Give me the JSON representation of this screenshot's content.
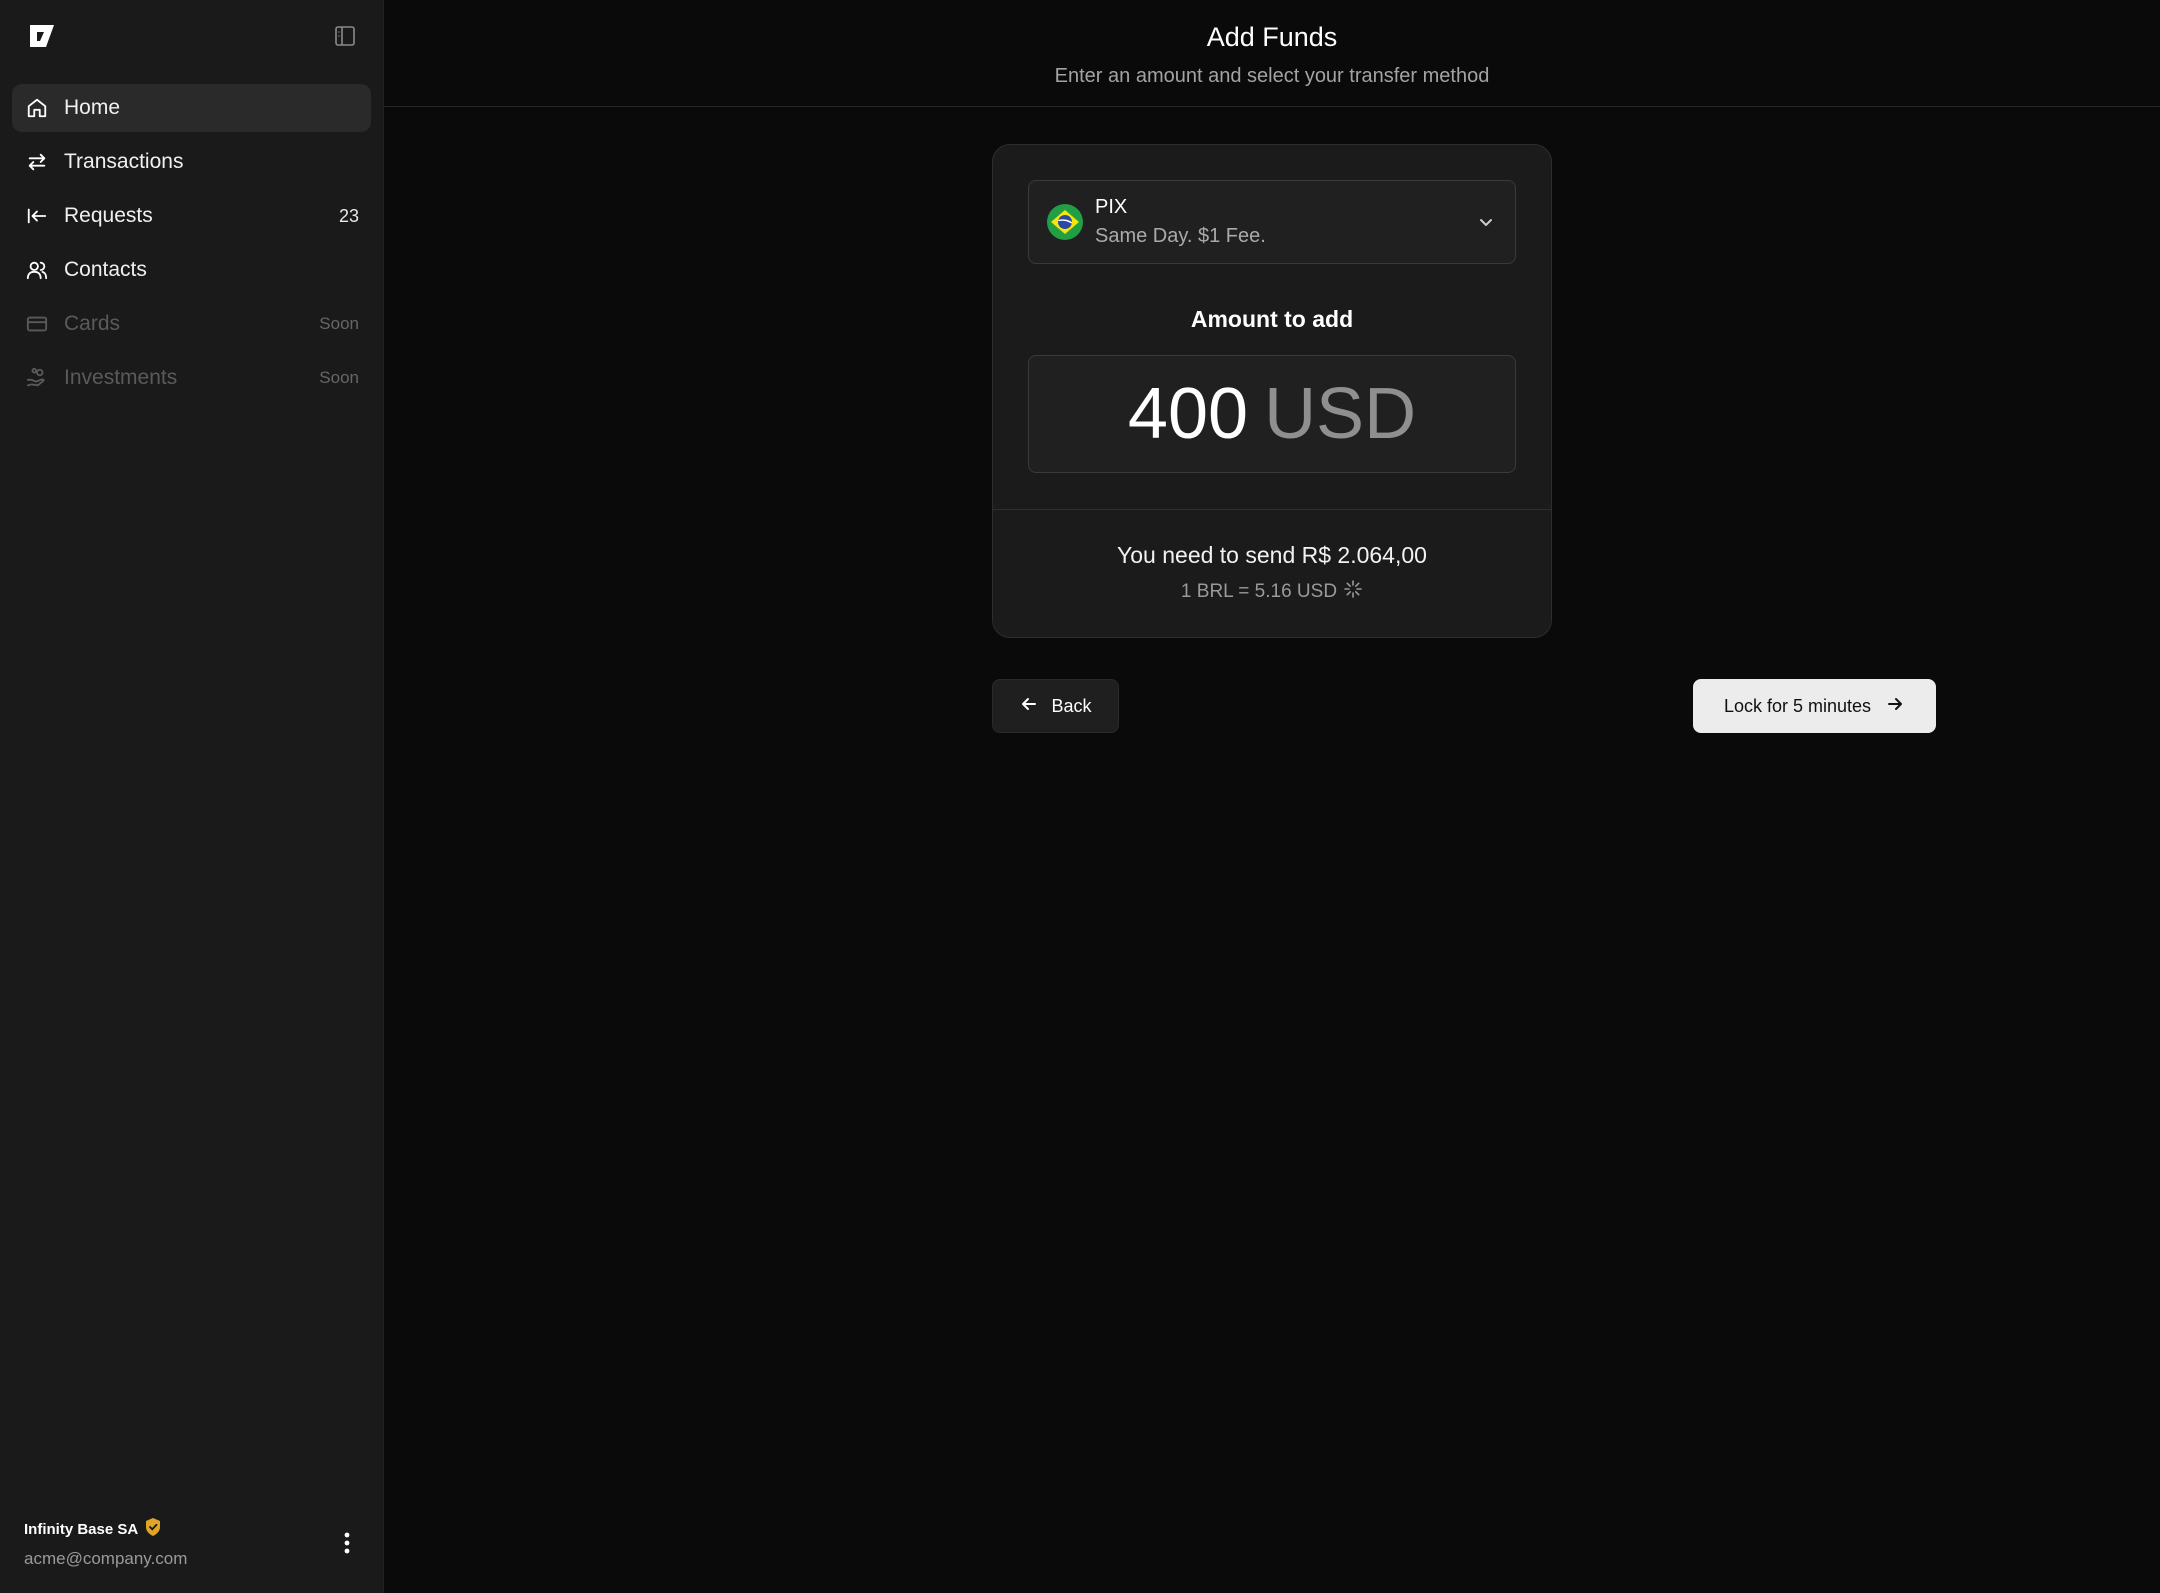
{
  "sidebar": {
    "logo_icon": "brand-logo-icon",
    "collapse_icon": "sidebar-toggle-icon",
    "items": [
      {
        "label": "Home",
        "icon": "home-icon",
        "badge": "",
        "active": true
      },
      {
        "label": "Transactions",
        "icon": "arrows-swap-icon",
        "badge": ""
      },
      {
        "label": "Requests",
        "icon": "arrow-left-to-line-icon",
        "badge": "23"
      },
      {
        "label": "Contacts",
        "icon": "users-icon",
        "badge": ""
      },
      {
        "label": "Cards",
        "icon": "credit-card-icon",
        "badge": "Soon",
        "disabled": true
      },
      {
        "label": "Investments",
        "icon": "hand-coins-icon",
        "badge": "Soon",
        "disabled": true
      }
    ],
    "account": {
      "name": "Infinity Base SA",
      "email": "acme@company.com",
      "verified_color": "#e0a526"
    }
  },
  "header": {
    "title": "Add Funds",
    "subtitle": "Enter an amount and select your transfer method"
  },
  "method": {
    "name": "PIX",
    "description": "Same Day. $1 Fee.",
    "flag": "brazil-flag-icon"
  },
  "amount": {
    "label": "Amount to add",
    "value": "400",
    "currency": "USD"
  },
  "conversion": {
    "send_text": "You need to send R$ 2.064,00",
    "rate_text": "1 BRL = 5.16 USD"
  },
  "actions": {
    "back_label": "Back",
    "lock_label": "Lock for 5 minutes"
  }
}
